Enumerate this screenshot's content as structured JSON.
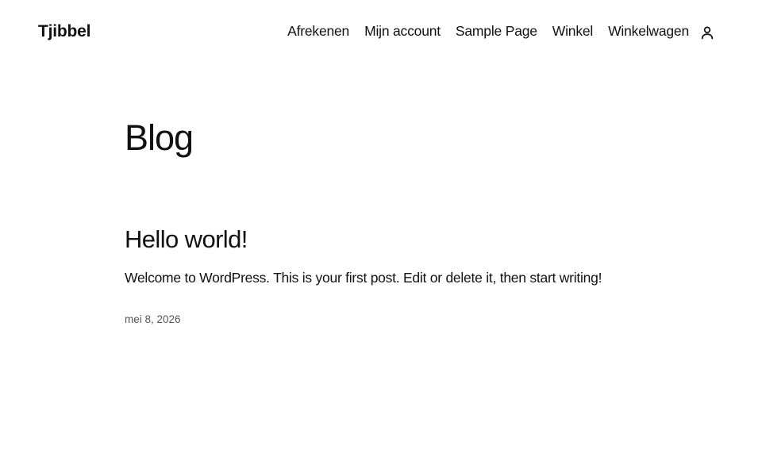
{
  "site": {
    "title": "Tjibbel"
  },
  "navigation": {
    "items": [
      {
        "label": "Afrekenen"
      },
      {
        "label": "Mijn account"
      },
      {
        "label": "Sample Page"
      },
      {
        "label": "Winkel"
      },
      {
        "label": "Winkelwagen"
      }
    ],
    "account_icon": "user-icon"
  },
  "page": {
    "title": "Blog"
  },
  "posts": [
    {
      "title": "Hello world!",
      "excerpt": "Welcome to WordPress. This is your first post. Edit or delete it, then start writing!",
      "date": "mei 8, 2026"
    }
  ]
}
